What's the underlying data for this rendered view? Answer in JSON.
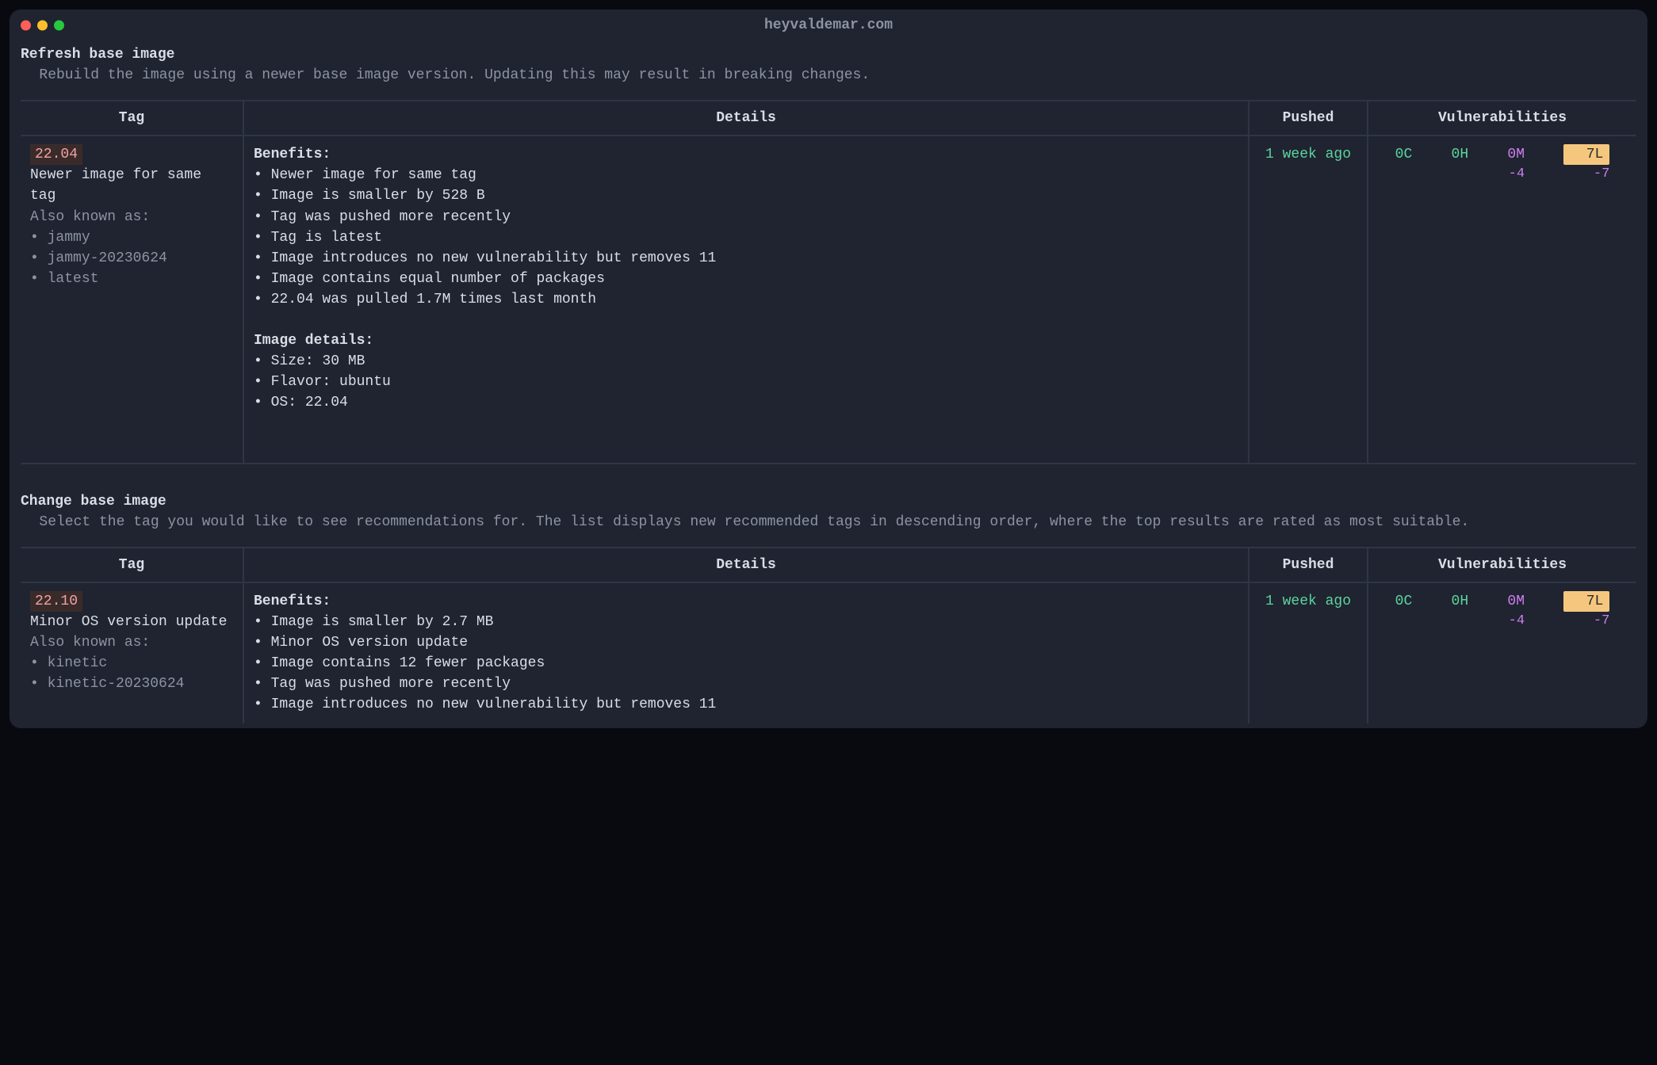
{
  "window": {
    "title": "heyvaldemar.com"
  },
  "section1": {
    "title": "Refresh base image",
    "desc": "Rebuild the image using a newer base image version. Updating this may result in breaking changes."
  },
  "tableHeaders": {
    "tag": "Tag",
    "details": "Details",
    "pushed": "Pushed",
    "vulns": "Vulnerabilities"
  },
  "row1": {
    "tag": "22.04",
    "tagline": "Newer image for same tag",
    "aka_label": "Also known as:",
    "aliases": [
      "jammy",
      "jammy-20230624",
      "latest"
    ],
    "benefits_label": "Benefits:",
    "benefits": [
      "Newer image for same tag",
      "Image is smaller by 528 B",
      "Tag was pushed more recently",
      "Tag is latest",
      "Image introduces no new vulnerability but removes 11",
      "Image contains equal number of packages",
      "22.04 was pulled 1.7M times last month"
    ],
    "imgdet_label": "Image details:",
    "imgdet": [
      "Size: 30 MB",
      "Flavor: ubuntu",
      "OS: 22.04"
    ],
    "pushed": "1 week ago",
    "vulns": {
      "c": "0C",
      "h": "0H",
      "m": "0M",
      "m_delta": "-4",
      "l": "7L",
      "l_delta": "-7"
    }
  },
  "section2": {
    "title": "Change base image",
    "desc": "Select the tag you would like to see recommendations for. The list displays new recommended tags in descending order, where the top results are rated as most suitable."
  },
  "row2": {
    "tag": "22.10",
    "tagline": "Minor OS version update",
    "aka_label": "Also known as:",
    "aliases": [
      "kinetic",
      "kinetic-20230624"
    ],
    "benefits_label": "Benefits:",
    "benefits": [
      "Image is smaller by 2.7 MB",
      "Minor OS version update",
      "Image contains 12 fewer packages",
      "Tag was pushed more recently",
      "Image introduces no new vulnerability but removes 11"
    ],
    "pushed": "1 week ago",
    "vulns": {
      "c": "0C",
      "h": "0H",
      "m": "0M",
      "m_delta": "-4",
      "l": "7L",
      "l_delta": "-7"
    }
  }
}
